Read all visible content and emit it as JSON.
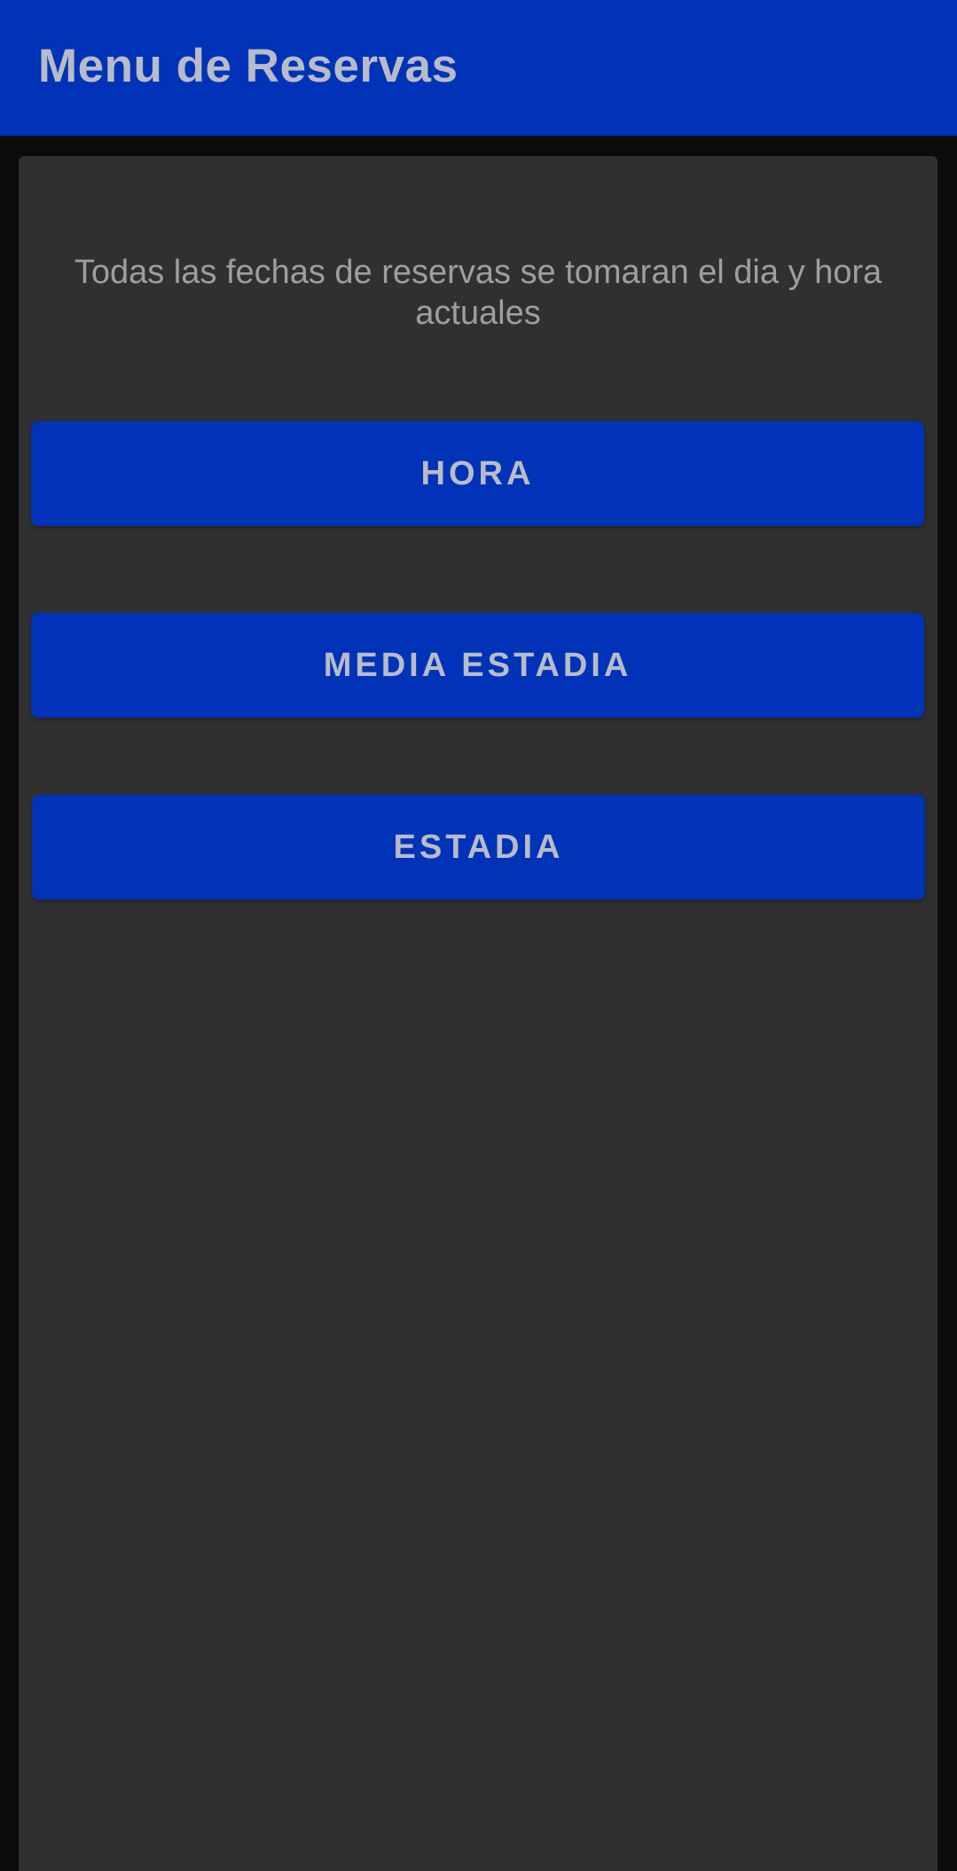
{
  "app_bar": {
    "title": "Menu de Reservas"
  },
  "content": {
    "info_text": "Todas las fechas de reservas se tomaran el dia y hora actuales",
    "buttons": [
      {
        "label": "HORA"
      },
      {
        "label": "MEDIA ESTADIA"
      },
      {
        "label": "ESTADIA"
      }
    ]
  },
  "colors": {
    "primary": "#0033b8",
    "surface": "#303030",
    "background": "#0b0b0b",
    "button_text": "#b8bcc8",
    "body_text": "#9e9e9e"
  }
}
